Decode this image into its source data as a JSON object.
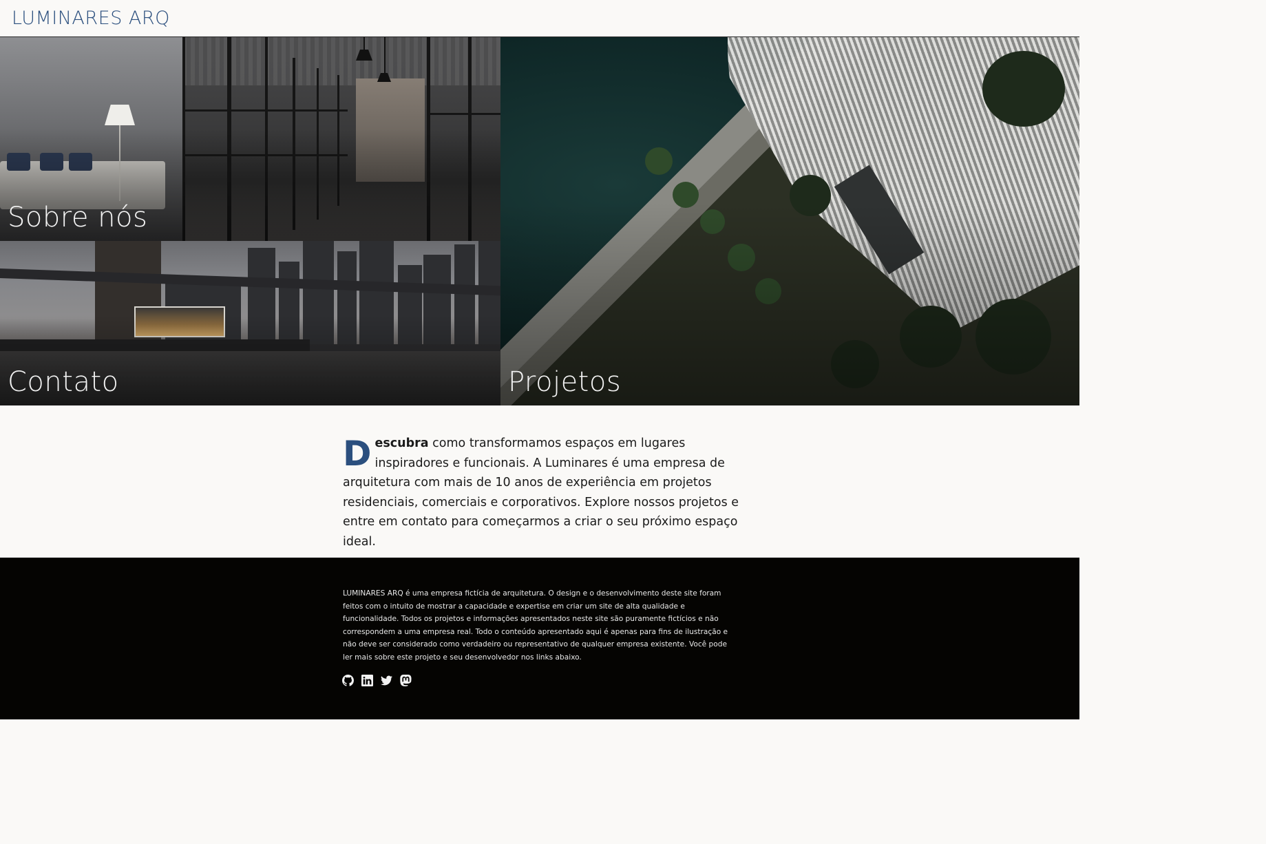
{
  "header": {
    "brand": "LUMINARES ARQ"
  },
  "hero": {
    "tiles": [
      {
        "label": "Sobre nós"
      },
      {
        "label": "Contato"
      },
      {
        "label": "Projetos"
      }
    ]
  },
  "intro": {
    "dropcap": "D",
    "lead_word": "escubra",
    "text": " como transformamos espaços em lugares inspiradores e funcionais. A Luminares é uma empresa de arquitetura com mais de 10 anos de experiência em projetos residenciais, comerciais e corporativos. Explore nossos projetos e entre em contato para começarmos a criar o seu próximo espaço ideal."
  },
  "footer": {
    "text": "LUMINARES ARQ é uma empresa fictícia de arquitetura. O design e o desenvolvimento deste site foram feitos com o intuito de mostrar a capacidade e expertise em criar um site de alta qualidade e funcionalidade. Todos os projetos e informações apresentados neste site são puramente fictícios e não correspondem a uma empresa real. Todo o conteúdo apresentado aqui é apenas para fins de ilustração e não deve ser considerado como verdadeiro ou representativo de qualquer empresa existente. Você pode ler mais sobre este projeto e seu desenvolvedor nos links abaixo.",
    "social": [
      {
        "icon": "github-icon"
      },
      {
        "icon": "linkedin-icon"
      },
      {
        "icon": "twitter-icon"
      },
      {
        "icon": "mastodon-icon"
      }
    ]
  },
  "colors": {
    "brand": "#2b4f7e",
    "background": "#faf9f7",
    "footer": "#050402"
  }
}
